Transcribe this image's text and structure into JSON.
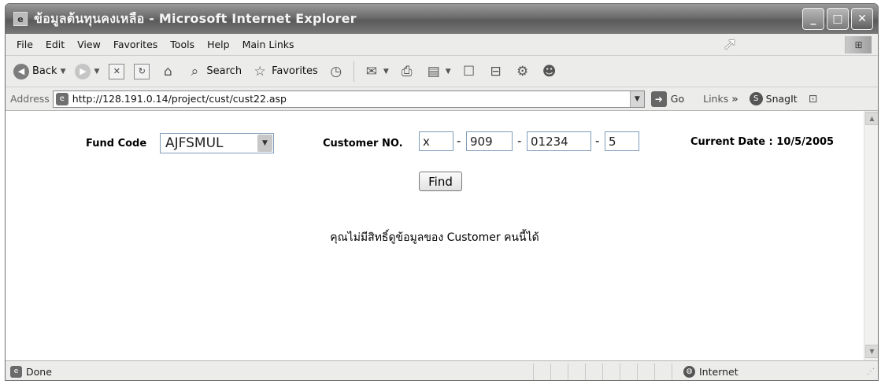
{
  "window": {
    "title": "ข้อมูลต้นทุนคงเหลือ - Microsoft Internet Explorer",
    "buttons": {
      "minimize": "_",
      "maximize": "□",
      "close": "✕"
    }
  },
  "menubar": {
    "items": [
      "File",
      "Edit",
      "View",
      "Favorites",
      "Tools",
      "Help",
      "Main Links"
    ]
  },
  "toolbar": {
    "back_label": "Back",
    "search_label": "Search",
    "favorites_label": "Favorites"
  },
  "addressbar": {
    "label": "Address",
    "url": "http://128.191.0.14/project/cust/cust22.asp",
    "go_label": "Go",
    "links_label": "Links",
    "snagit_label": "SnagIt"
  },
  "form": {
    "fund_code_label": "Fund Code",
    "fund_code_value": "AJFSMUL",
    "customer_no_label": "Customer NO.",
    "customer_no_parts": [
      "x",
      "909",
      "01234",
      "5"
    ],
    "dash": "-",
    "find_label": "Find",
    "current_date": "Current Date : 10/5/2005"
  },
  "message": "คุณไม่มีสิทธิ์ดูข้อมูลของ Customer คนนี้ได้",
  "statusbar": {
    "status": "Done",
    "zone": "Internet"
  }
}
